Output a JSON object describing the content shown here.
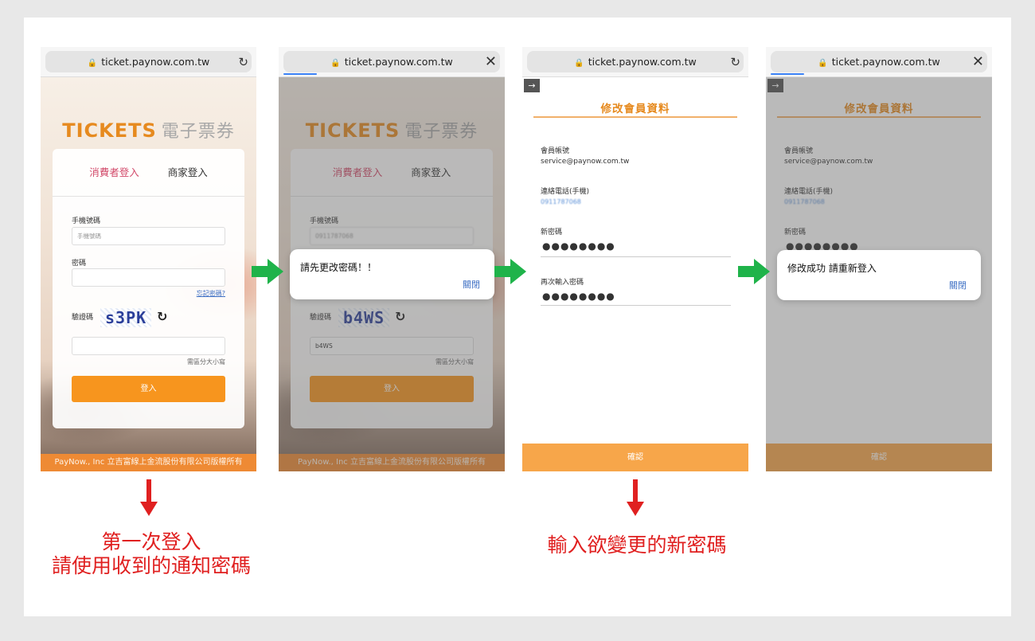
{
  "browser": {
    "url": "ticket.paynow.com.tw"
  },
  "login": {
    "logo_brand": "TICKETS",
    "logo_cn": "電子票券",
    "tab_consumer": "消費者登入",
    "tab_merchant": "商家登入",
    "phone_label": "手機號碼",
    "phone_placeholder": "手機號碼",
    "phone_value_filled": "0911787068",
    "password_label": "密碼",
    "forgot": "忘記密碼?",
    "captcha_label": "驗證碼",
    "captcha_1": "s3PK",
    "captcha_2": "b4WS",
    "captcha_input_2": "b4WS",
    "case_hint": "需區分大小寫",
    "login_button": "登入",
    "footer": "PayNow., Inc 立吉富線上金流股份有限公司版權所有"
  },
  "dialog_1": {
    "message": "請先更改密碼！！",
    "close": "關閉"
  },
  "profile": {
    "title": "修改會員資料",
    "account_label": "會員帳號",
    "account_value": "service@paynow.com.tw",
    "phone_label": "連絡電話(手機)",
    "phone_value": "0911787068",
    "new_password_label": "新密碼",
    "confirm_password_label": "再次輸入密碼",
    "masked": "●●●●●●●●",
    "confirm_button": "確認"
  },
  "dialog_2": {
    "message": "修改成功 請重新登入",
    "close": "關閉"
  },
  "annotations": {
    "left_line1": "第一次登入",
    "left_line2": "請使用收到的通知密碼",
    "right": "輸入欲變更的新密碼"
  },
  "colors": {
    "brand": "#e68a1f",
    "arrow_green": "#1fb34a",
    "note_red": "#e02020",
    "link": "#3d6fc4"
  }
}
